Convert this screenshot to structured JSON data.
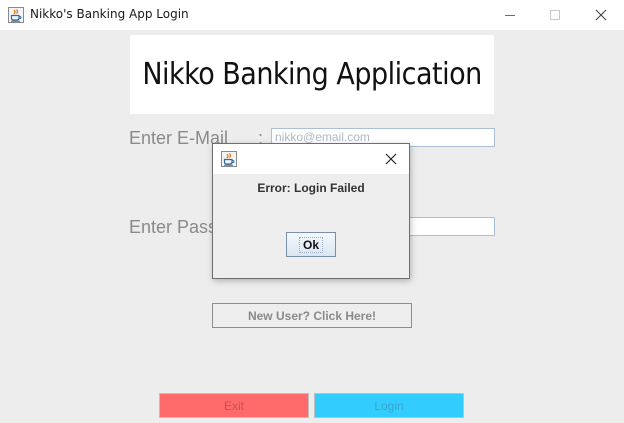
{
  "window": {
    "title": "Nikko's Banking App Login",
    "icon": "java-icon",
    "controls": {
      "minimize_icon": "minimize-icon",
      "maximize_icon": "maximize-icon",
      "close_icon": "close-icon"
    }
  },
  "banner": {
    "title": "Nikko Banking Application"
  },
  "form": {
    "email_label": "Enter E-Mail",
    "colon": ":",
    "email_placeholder": "nikko@email.com",
    "password_label": "Enter Pass",
    "password_value": ""
  },
  "buttons": {
    "new_user": "New User? Click Here!",
    "exit": "Exit",
    "login": "Login"
  },
  "dialog": {
    "icon": "java-icon",
    "close_icon": "close-icon",
    "message": "Error: Login Failed",
    "ok_label": "Ok"
  },
  "colors": {
    "exit_button": "#ff6b6b",
    "login_button": "#33ccff",
    "banner_background": "#ffffff"
  }
}
